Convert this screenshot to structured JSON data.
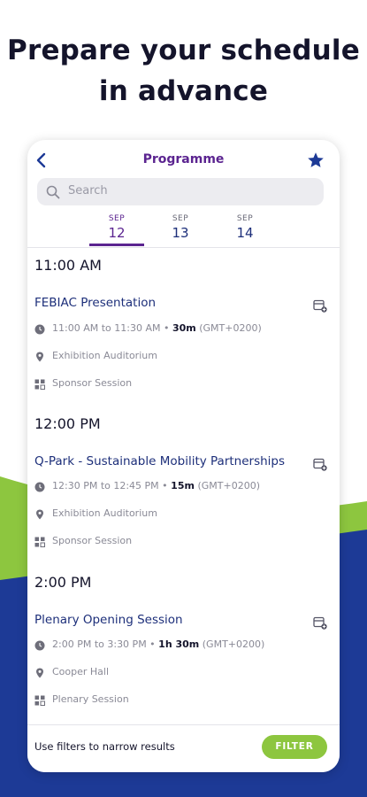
{
  "headline": {
    "line1": "Prepare your schedule",
    "line2": "in advance"
  },
  "colors": {
    "brand_purple": "#5b2490",
    "brand_navy": "#1d3a96",
    "brand_green": "#8dc63f"
  },
  "app": {
    "title": "Programme",
    "back_icon": "chevron-left-icon",
    "favorite_icon": "star-icon",
    "search": {
      "placeholder": "Search"
    },
    "date_tabs": [
      {
        "month": "SEP",
        "day": "12",
        "active": true
      },
      {
        "month": "SEP",
        "day": "13",
        "active": false
      },
      {
        "month": "SEP",
        "day": "14",
        "active": false
      }
    ],
    "groups": [
      {
        "time": "11:00 AM",
        "session": {
          "title": "FEBIAC Presentation",
          "time_range": "11:00 AM to 11:30 AM",
          "duration": "30m",
          "timezone": "(GMT+0200)",
          "location": "Exhibition Auditorium",
          "type": "Sponsor Session"
        }
      },
      {
        "time": "12:00 PM",
        "session": {
          "title": "Q-Park - Sustainable Mobility Partnerships",
          "time_range": "12:30 PM to 12:45 PM",
          "duration": "15m",
          "timezone": "(GMT+0200)",
          "location": "Exhibition Auditorium",
          "type": "Sponsor Session"
        }
      },
      {
        "time": "2:00 PM",
        "session": {
          "title": "Plenary Opening Session",
          "time_range": "2:00 PM to 3:30 PM",
          "duration": "1h 30m",
          "timezone": "(GMT+0200)",
          "location": "Cooper Hall",
          "type": "Plenary Session"
        }
      }
    ],
    "footer": {
      "hint": "Use filters to narrow results",
      "filter_label": "FILTER"
    }
  }
}
